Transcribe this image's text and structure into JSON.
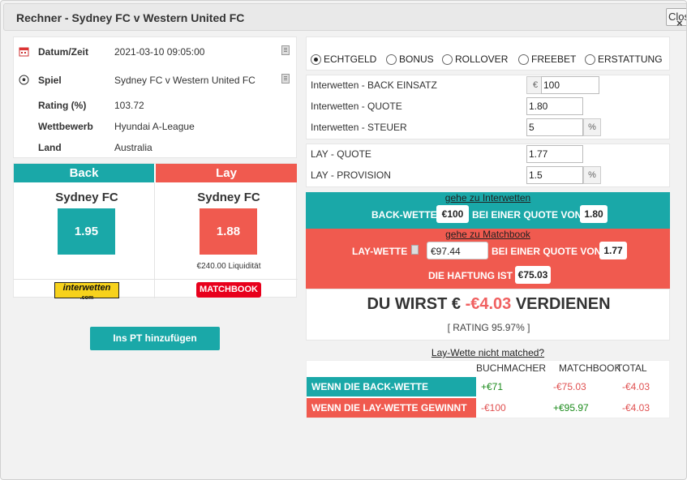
{
  "dialog": {
    "title": "Rechner - Sydney FC v Western United FC",
    "close_label": "Close",
    "close_icon": "×"
  },
  "info": [
    {
      "label": "Datum/Zeit",
      "value": "2021-03-10 09:05:00",
      "icon": "calendar-icon"
    },
    {
      "label": "Spiel",
      "value": "Sydney FC v Western United FC",
      "icon": "soccer-ball-icon"
    },
    {
      "label": "Rating (%)",
      "value": "103.72"
    },
    {
      "label": "Wettbewerb",
      "value": "Hyundai A-League"
    },
    {
      "label": "Land",
      "value": "Australia"
    }
  ],
  "back": {
    "header": "Back",
    "team": "Sydney FC",
    "odds": "1.95",
    "bookmaker": "interwetten",
    "bookmaker_sub": ".com",
    "color": "#1aa8a8"
  },
  "lay": {
    "header": "Lay",
    "team": "Sydney FC",
    "odds": "1.88",
    "liquidity": "€240.00 Liquidität",
    "exchange": "MATCHBOOK",
    "color": "#f05a4f"
  },
  "add_button": "Ins PT hinzufügen",
  "bet_types": [
    {
      "label": "ECHTGELD",
      "selected": true
    },
    {
      "label": "BONUS",
      "selected": false
    },
    {
      "label": "ROLLOVER",
      "selected": false
    },
    {
      "label": "FREEBET",
      "selected": false
    },
    {
      "label": "ERSTATTUNG",
      "selected": false
    }
  ],
  "fields": {
    "back_stake": {
      "label": "Interwetten - BACK EINSATZ",
      "prefix": "€",
      "value": "100"
    },
    "back_odds": {
      "label": "Interwetten - QUOTE",
      "value": "1.80"
    },
    "back_tax": {
      "label": "Interwetten - STEUER",
      "value": "5",
      "suffix": "%"
    },
    "lay_odds": {
      "label": "LAY - QUOTE",
      "value": "1.77"
    },
    "lay_commission": {
      "label": "LAY - PROVISION",
      "value": "1.5",
      "suffix": "%"
    }
  },
  "back_bet": {
    "link": "gehe zu Interwetten",
    "text1": "BACK-WETTE",
    "stake": "€100",
    "text2": "BEI EINER QUOTE VON",
    "odds": "1.80"
  },
  "lay_bet": {
    "link": "gehe zu Matchbook",
    "text1": "LAY-WETTE",
    "stake": "€97.44",
    "text2": "BEI EINER QUOTE VON",
    "odds": "1.77",
    "liability_label": "DIE HAFTUNG IST",
    "liability": "€75.03"
  },
  "result": {
    "prefix": "DU WIRST €",
    "amount": "-€4.03",
    "suffix": "VERDIENEN",
    "rating": "[ RATING 95.97% ]"
  },
  "not_matched_link": "Lay-Wette nicht matched?",
  "summary": {
    "headers": [
      "BUCHMACHER",
      "MATCHBOOK",
      "TOTAL"
    ],
    "rows": [
      {
        "label": "WENN DIE BACK-WETTE GEWINNT",
        "bookmaker": "+€71",
        "exchange": "-€75.03",
        "total": "-€4.03"
      },
      {
        "label": "WENN DIE LAY-WETTE GEWINNT",
        "bookmaker": "-€100",
        "exchange": "+€95.97",
        "total": "-€4.03"
      }
    ]
  }
}
